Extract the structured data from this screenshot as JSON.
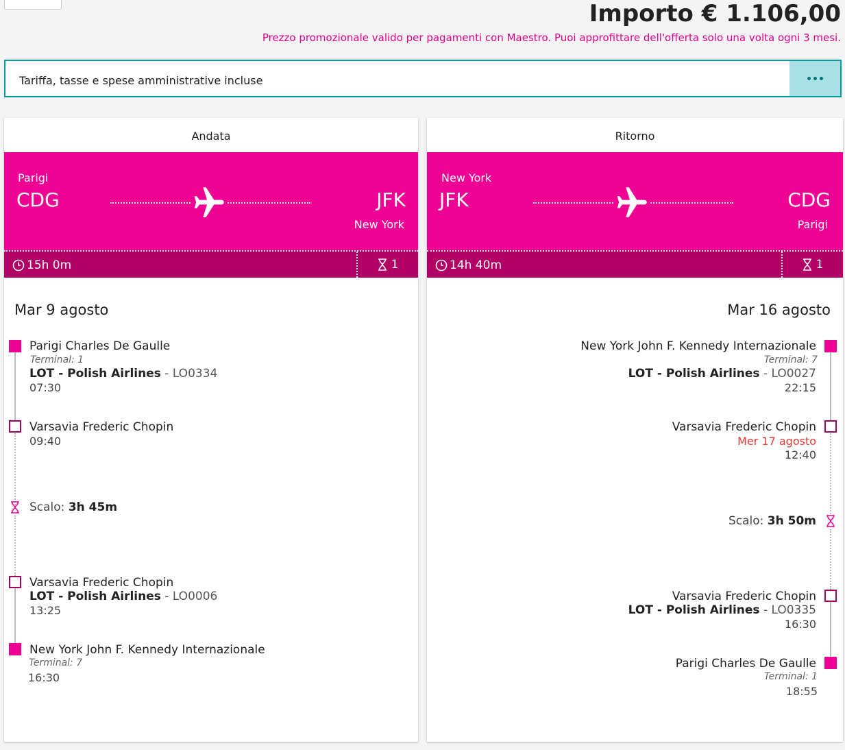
{
  "header": {
    "price": "Importo € 1.106,00",
    "promo": "Prezzo promozionale valido per pagamenti con Maestro. Puoi approfittare dell'offerta solo una volta ogni 3 mesi.",
    "tariff_note": "Tariffa, tasse e spese amministrative incluse",
    "more_icon": "ellipsis-icon"
  },
  "colors": {
    "brand": "#ed0293",
    "brand_dark": "#b30066",
    "accent": "#009e9e",
    "accent_light": "#a9e0e3",
    "alert": "#e53935"
  },
  "outbound": {
    "title": "Andata",
    "from_city": "Parigi",
    "from_code": "CDG",
    "to_code": "JFK",
    "to_city": "New York",
    "duration": "15h 0m",
    "stops": "1",
    "date": "Mar 9 agosto",
    "seg1_from": {
      "airport": "Parigi Charles De Gaulle",
      "terminal": "Terminal: 1",
      "airline": "LOT - Polish Airlines",
      "flight": " - LO0334",
      "time": "07:30"
    },
    "seg1_to": {
      "airport": "Varsavia Frederic Chopin",
      "time": "09:40"
    },
    "layover": {
      "label": "Scalo: ",
      "value": "3h 45m"
    },
    "seg2_from": {
      "airport": "Varsavia Frederic Chopin",
      "airline": "LOT - Polish Airlines",
      "flight": " - LO0006",
      "time": "13:25"
    },
    "seg2_to": {
      "airport": "New York John F. Kennedy Internazionale",
      "terminal": "Terminal: 7",
      "time": "16:30"
    }
  },
  "return": {
    "title": "Ritorno",
    "from_city": "New York",
    "from_code": "JFK",
    "to_code": "CDG",
    "to_city": "Parigi",
    "duration": "14h 40m",
    "stops": "1",
    "date": "Mar 16 agosto",
    "seg1_from": {
      "airport": "New York John F. Kennedy Internazionale",
      "terminal": "Terminal: 7",
      "airline": "LOT - Polish Airlines",
      "flight": " - LO0027",
      "time": "22:15"
    },
    "seg1_to": {
      "airport": "Varsavia Frederic Chopin",
      "date_change": "Mer 17 agosto",
      "time": "12:40"
    },
    "layover": {
      "label": "Scalo: ",
      "value": "3h 50m"
    },
    "seg2_from": {
      "airport": "Varsavia Frederic Chopin",
      "airline": "LOT - Polish Airlines",
      "flight": " - LO0335",
      "time": "16:30"
    },
    "seg2_to": {
      "airport": "Parigi Charles De Gaulle",
      "terminal": "Terminal: 1",
      "time": "18:55"
    }
  }
}
